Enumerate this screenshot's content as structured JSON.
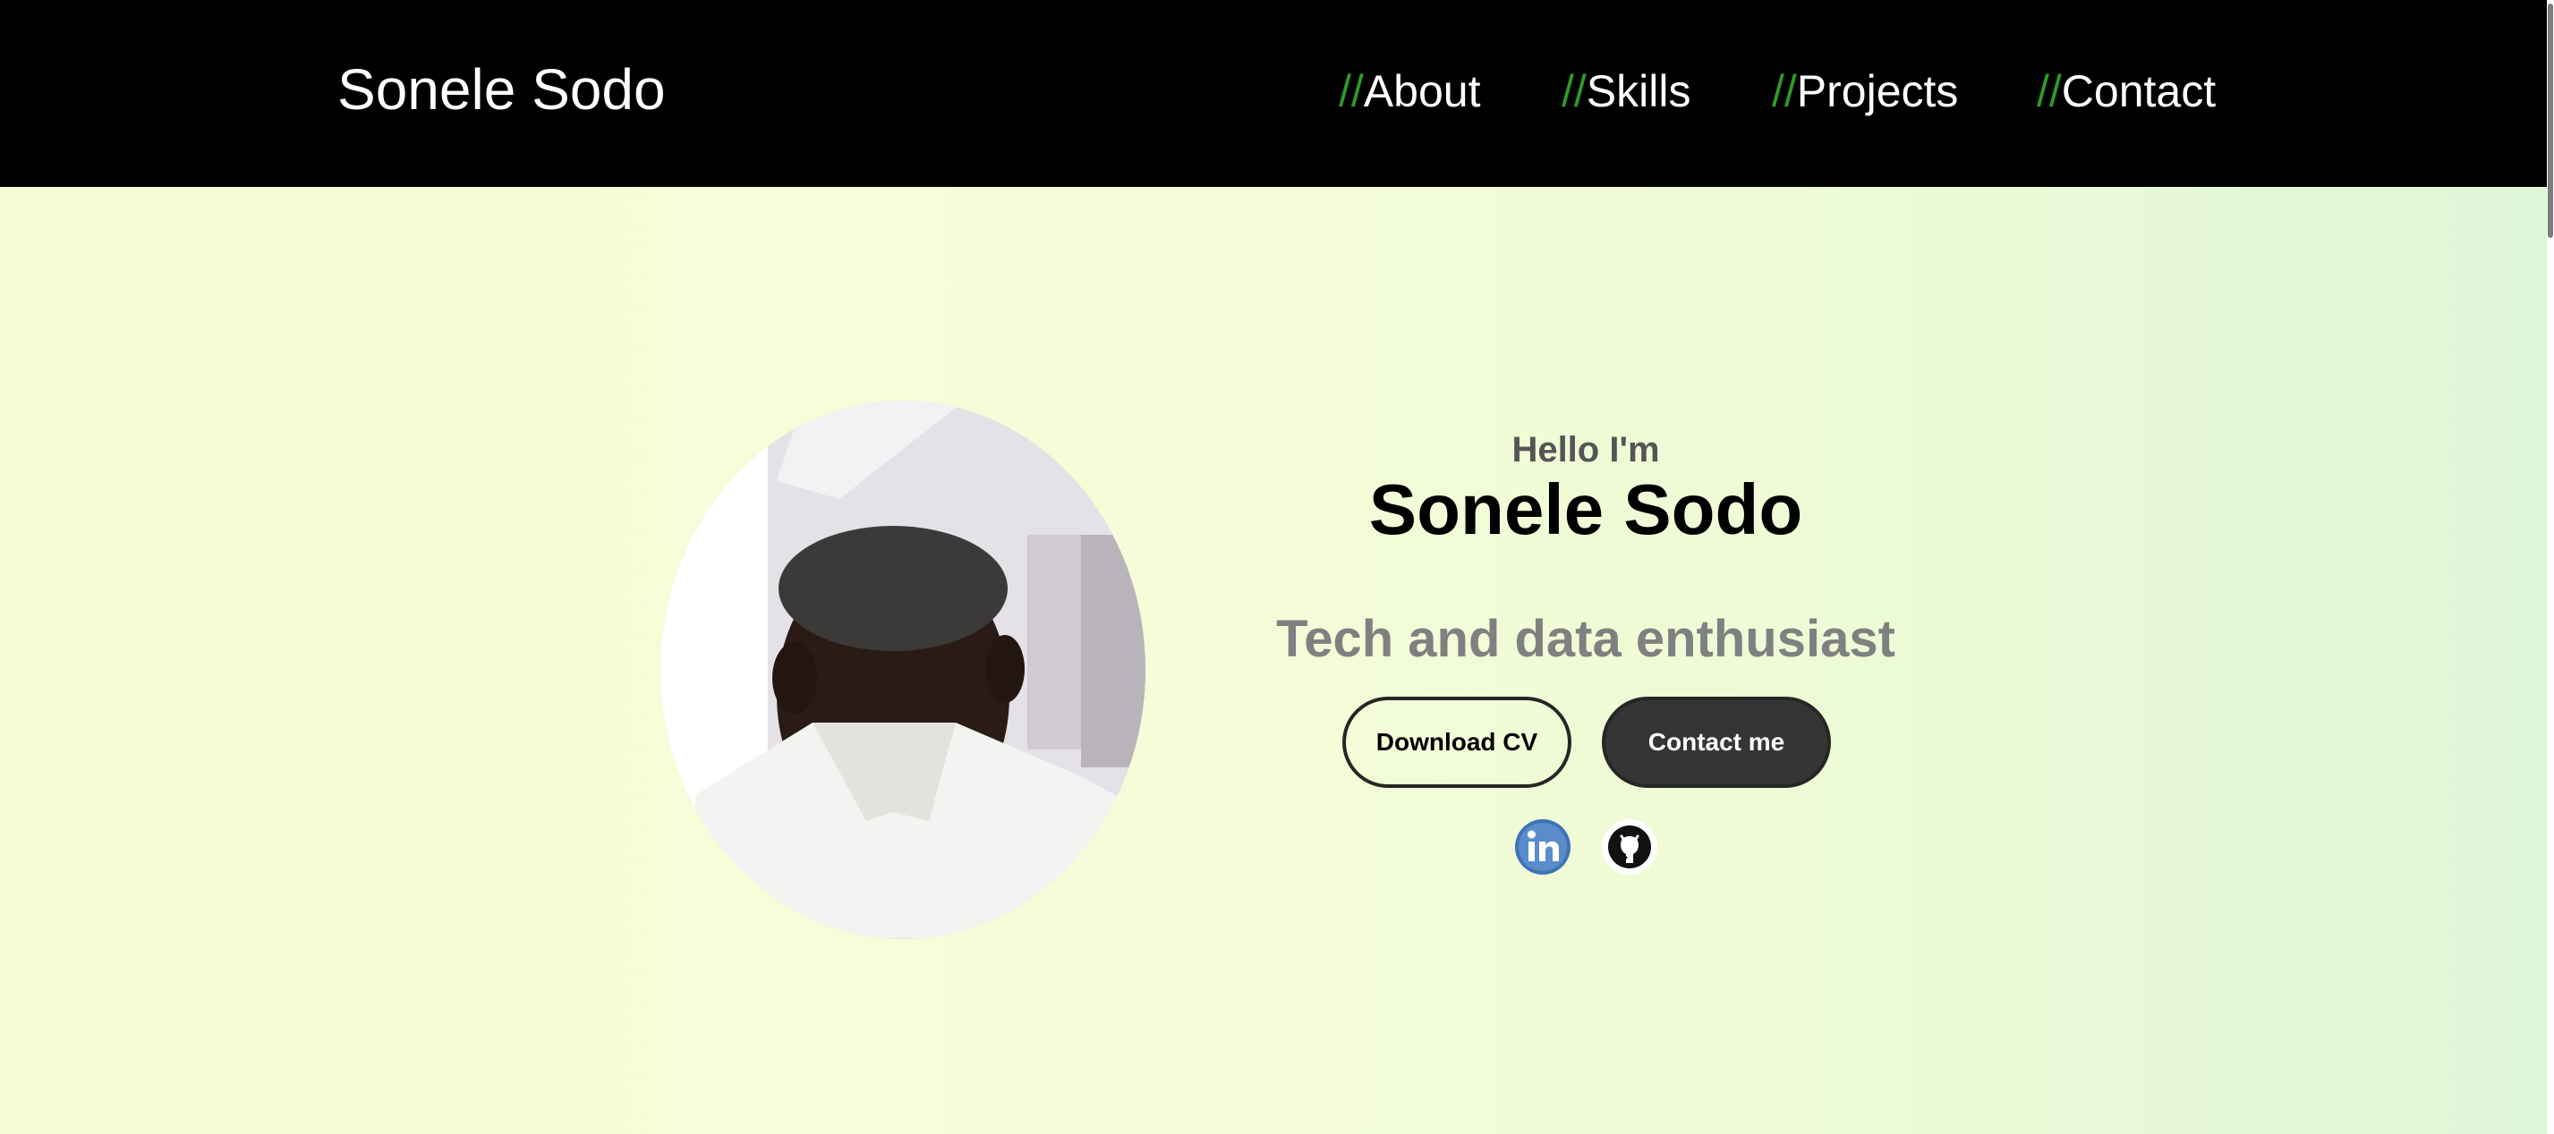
{
  "header": {
    "brand": "Sonele Sodo",
    "nav": [
      {
        "prefix": "//",
        "label": "About"
      },
      {
        "prefix": "//",
        "label": "Skills"
      },
      {
        "prefix": "//",
        "label": "Projects"
      },
      {
        "prefix": "//",
        "label": "Contact"
      }
    ]
  },
  "hero": {
    "greeting": "Hello I'm",
    "name": "Sonele Sodo",
    "tagline": "Tech and data enthusiast",
    "buttons": {
      "download_cv": "Download CV",
      "contact_me": "Contact me"
    },
    "social": [
      {
        "icon": "linkedin-icon"
      },
      {
        "icon": "github-icon"
      }
    ]
  },
  "colors": {
    "header_bg": "#000000",
    "accent_slash": "#2e9a2a",
    "tagline": "#808080",
    "button_dark": "#353535"
  }
}
